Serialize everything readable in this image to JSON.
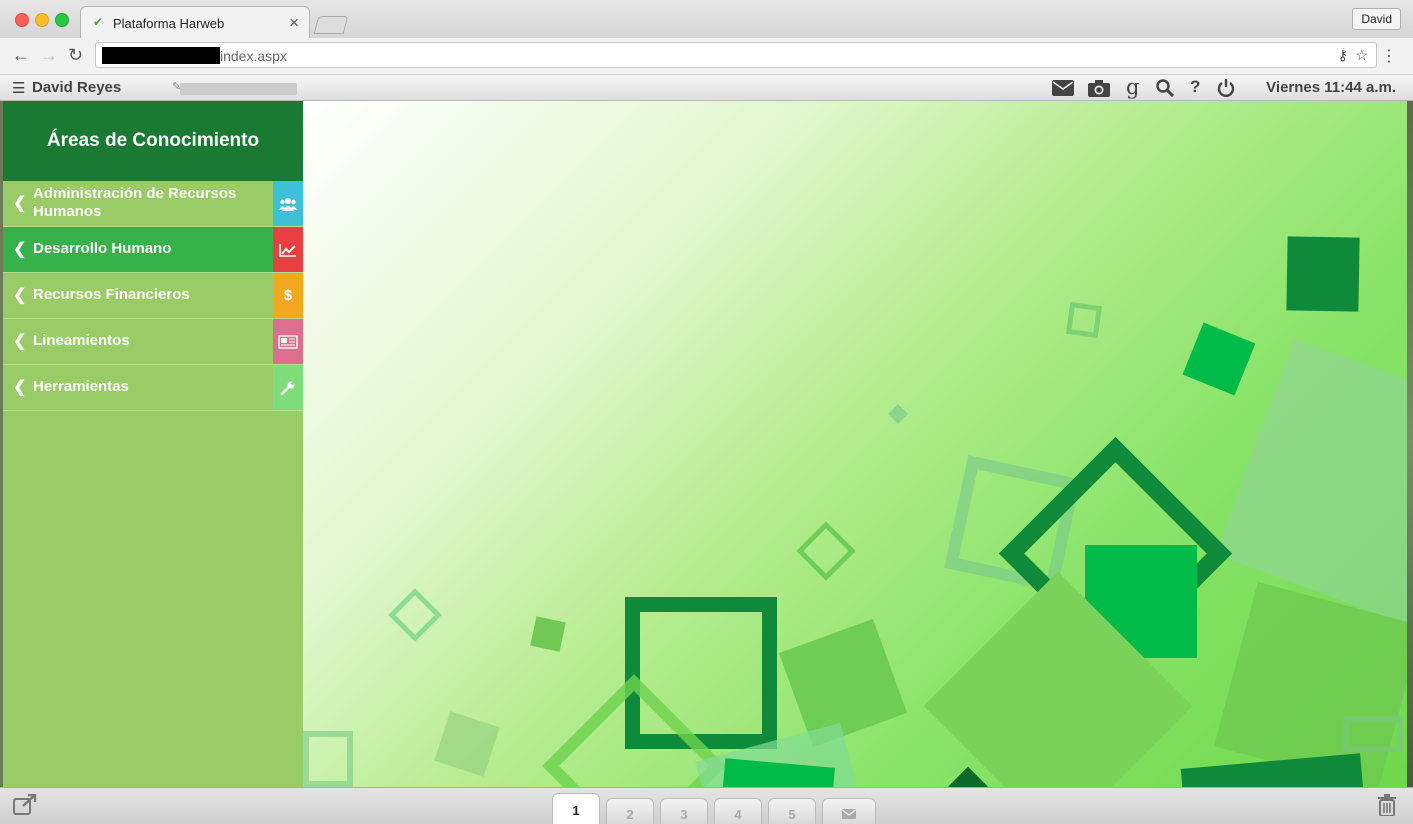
{
  "browser": {
    "tab_title": "Plataforma Harweb",
    "tab_close": "×",
    "profile_name": "David",
    "url_suffix": "index.aspx"
  },
  "appbar": {
    "user": "David Reyes",
    "clock": "Viernes 11:44 a.m.",
    "icons": [
      "mail-icon",
      "camera-icon",
      "google-icon",
      "search-icon",
      "help-icon",
      "power-icon"
    ],
    "google_glyph": "g",
    "help_glyph": "?"
  },
  "sidebar": {
    "title": "Áreas de Conocimiento",
    "items": [
      {
        "label": "Administración de Recursos Humanos",
        "icon": "users-icon",
        "icon_color": "#3fc0d8"
      },
      {
        "label": "Desarrollo Humano",
        "icon": "chart-line-icon",
        "icon_color": "#e84040"
      },
      {
        "label": "Recursos Financieros",
        "icon": "dollar-icon",
        "icon_color": "#f5a623",
        "icon_glyph": "$"
      },
      {
        "label": "Lineamientos",
        "icon": "newspaper-icon",
        "icon_color": "#dd6e8e"
      },
      {
        "label": "Herramientas",
        "icon": "wrench-icon",
        "icon_color": "#7fdc7a"
      }
    ],
    "active_index": 1
  },
  "bottombar": {
    "pages": [
      "1",
      "2",
      "3",
      "4",
      "5"
    ],
    "active_page": "1",
    "mail_tab_icon": "envelope-icon"
  },
  "colors": {
    "sidebar_bg": "#99cc66",
    "sidebar_header": "#1a7a34",
    "active_item": "#37b24a"
  }
}
